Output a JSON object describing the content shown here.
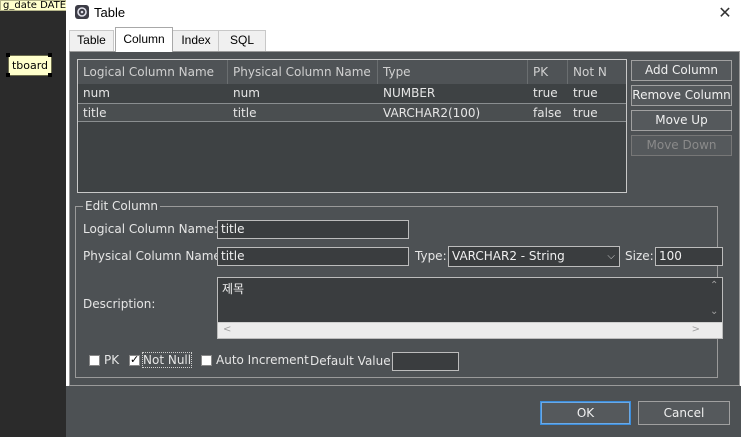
{
  "background": {
    "top_label": "g_date DATE",
    "entity_label": "tboard"
  },
  "dialog": {
    "title": "Table",
    "close_label": "✕"
  },
  "tabs": [
    {
      "label": "Table"
    },
    {
      "label": "Column"
    },
    {
      "label": "Index"
    },
    {
      "label": "SQL"
    }
  ],
  "table": {
    "headers": [
      "Logical Column Name",
      "Physical Column Name",
      "Type",
      "PK",
      "Not N"
    ],
    "rows": [
      [
        "num",
        "num",
        "NUMBER",
        "true",
        "true"
      ],
      [
        "title",
        "title",
        "VARCHAR2(100)",
        "false",
        "true"
      ]
    ],
    "selected_row": 1
  },
  "side_buttons": {
    "add": "Add Column",
    "remove": "Remove Column",
    "up": "Move Up",
    "down": "Move Down"
  },
  "edit": {
    "legend": "Edit Column",
    "logical_label": "Logical Column Name:",
    "logical_value": "title",
    "physical_label": "Physical Column Name:",
    "physical_value": "title",
    "type_label": "Type:",
    "type_value": "VARCHAR2 - String",
    "size_label": "Size:",
    "size_value": "100",
    "description_label": "Description:",
    "description_value": "제목",
    "pk_label": "PK",
    "pk_checked": false,
    "notnull_label": "Not Null",
    "notnull_checked": true,
    "autoinc_label": "Auto Increment",
    "autoinc_checked": false,
    "default_label": "Default Value:",
    "default_value": ""
  },
  "footer": {
    "ok": "OK",
    "cancel": "Cancel"
  },
  "colors": {
    "panel": "#4d5154",
    "table_bg": "#3e4244",
    "ok_border": "#3c8ddb"
  }
}
